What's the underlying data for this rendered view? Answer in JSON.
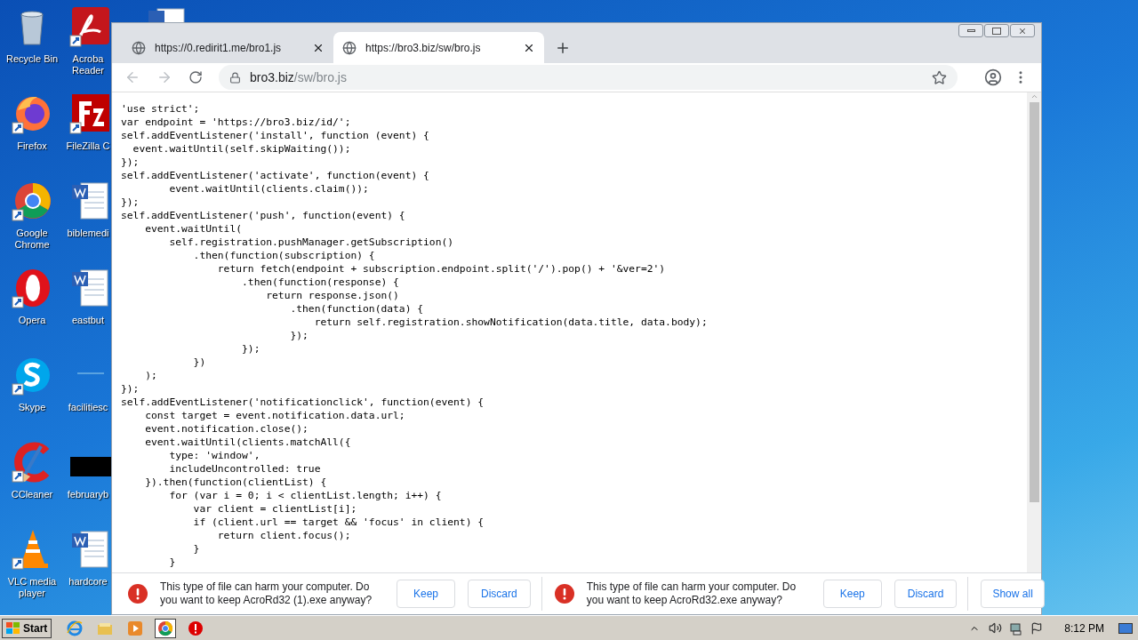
{
  "desktop_icons": [
    {
      "label": "Recycle Bin",
      "kind": "bin",
      "shortcut": false
    },
    {
      "label": "Acroba Reader",
      "kind": "pdf",
      "shortcut": true
    },
    {
      "label": "Firefox",
      "kind": "firefox",
      "shortcut": true
    },
    {
      "label": "FileZilla C",
      "kind": "filezilla",
      "shortcut": true
    },
    {
      "label": "Google Chrome",
      "kind": "chrome",
      "shortcut": true
    },
    {
      "label": "biblemedi",
      "kind": "word",
      "shortcut": false
    },
    {
      "label": "Opera",
      "kind": "opera",
      "shortcut": true
    },
    {
      "label": "eastbut",
      "kind": "word",
      "shortcut": false
    },
    {
      "label": "Skype",
      "kind": "skype",
      "shortcut": true
    },
    {
      "label": "facilitiesc",
      "kind": "blank",
      "shortcut": false
    },
    {
      "label": "CCleaner",
      "kind": "ccleaner",
      "shortcut": true
    },
    {
      "label": "februaryb",
      "kind": "black",
      "shortcut": false
    },
    {
      "label": "VLC media player",
      "kind": "vlc",
      "shortcut": true
    },
    {
      "label": "hardcore",
      "kind": "word",
      "shortcut": false
    }
  ],
  "browser": {
    "tabs": [
      {
        "title": "https://0.redirit1.me/bro1.js",
        "selected": false
      },
      {
        "title": "https://bro3.biz/sw/bro.js",
        "selected": true
      }
    ],
    "address": {
      "host": "bro3.biz",
      "path": "/sw/bro.js"
    },
    "code_lines": [
      "'use strict';",
      "var endpoint = 'https://bro3.biz/id/';",
      "self.addEventListener('install', function (event) {",
      "  event.waitUntil(self.skipWaiting());",
      "});",
      "self.addEventListener('activate', function(event) {",
      "        event.waitUntil(clients.claim());",
      "});",
      "self.addEventListener('push', function(event) {",
      "    event.waitUntil(",
      "        self.registration.pushManager.getSubscription()",
      "            .then(function(subscription) {",
      "                return fetch(endpoint + subscription.endpoint.split('/').pop() + '&ver=2')",
      "                    .then(function(response) {",
      "                        return response.json()",
      "                            .then(function(data) {",
      "                                return self.registration.showNotification(data.title, data.body);",
      "                            });",
      "                    });",
      "            })",
      "    );",
      "});",
      "self.addEventListener('notificationclick', function(event) {",
      "    const target = event.notification.data.url;",
      "    event.notification.close();",
      "    event.waitUntil(clients.matchAll({",
      "        type: 'window',",
      "        includeUncontrolled: true",
      "    }).then(function(clientList) {",
      "        for (var i = 0; i < clientList.length; i++) {",
      "            var client = clientList[i];",
      "            if (client.url == target && 'focus' in client) {",
      "                return client.focus();",
      "            }",
      "        }"
    ],
    "downloads": [
      {
        "message": "This type of file can harm your computer. Do you want to keep AcroRd32 (1).exe anyway?",
        "keep": "Keep",
        "discard": "Discard"
      },
      {
        "message": "This type of file can harm your computer. Do you want to keep AcroRd32.exe anyway?",
        "keep": "Keep",
        "discard": "Discard"
      }
    ],
    "show_all": "Show all"
  },
  "taskbar": {
    "start": "Start",
    "apps": [
      {
        "kind": "ie",
        "active": false
      },
      {
        "kind": "explorer",
        "active": false
      },
      {
        "kind": "media",
        "active": false
      },
      {
        "kind": "chrome",
        "active": true
      },
      {
        "kind": "redapp",
        "active": false
      }
    ],
    "time": "8:12 PM"
  }
}
